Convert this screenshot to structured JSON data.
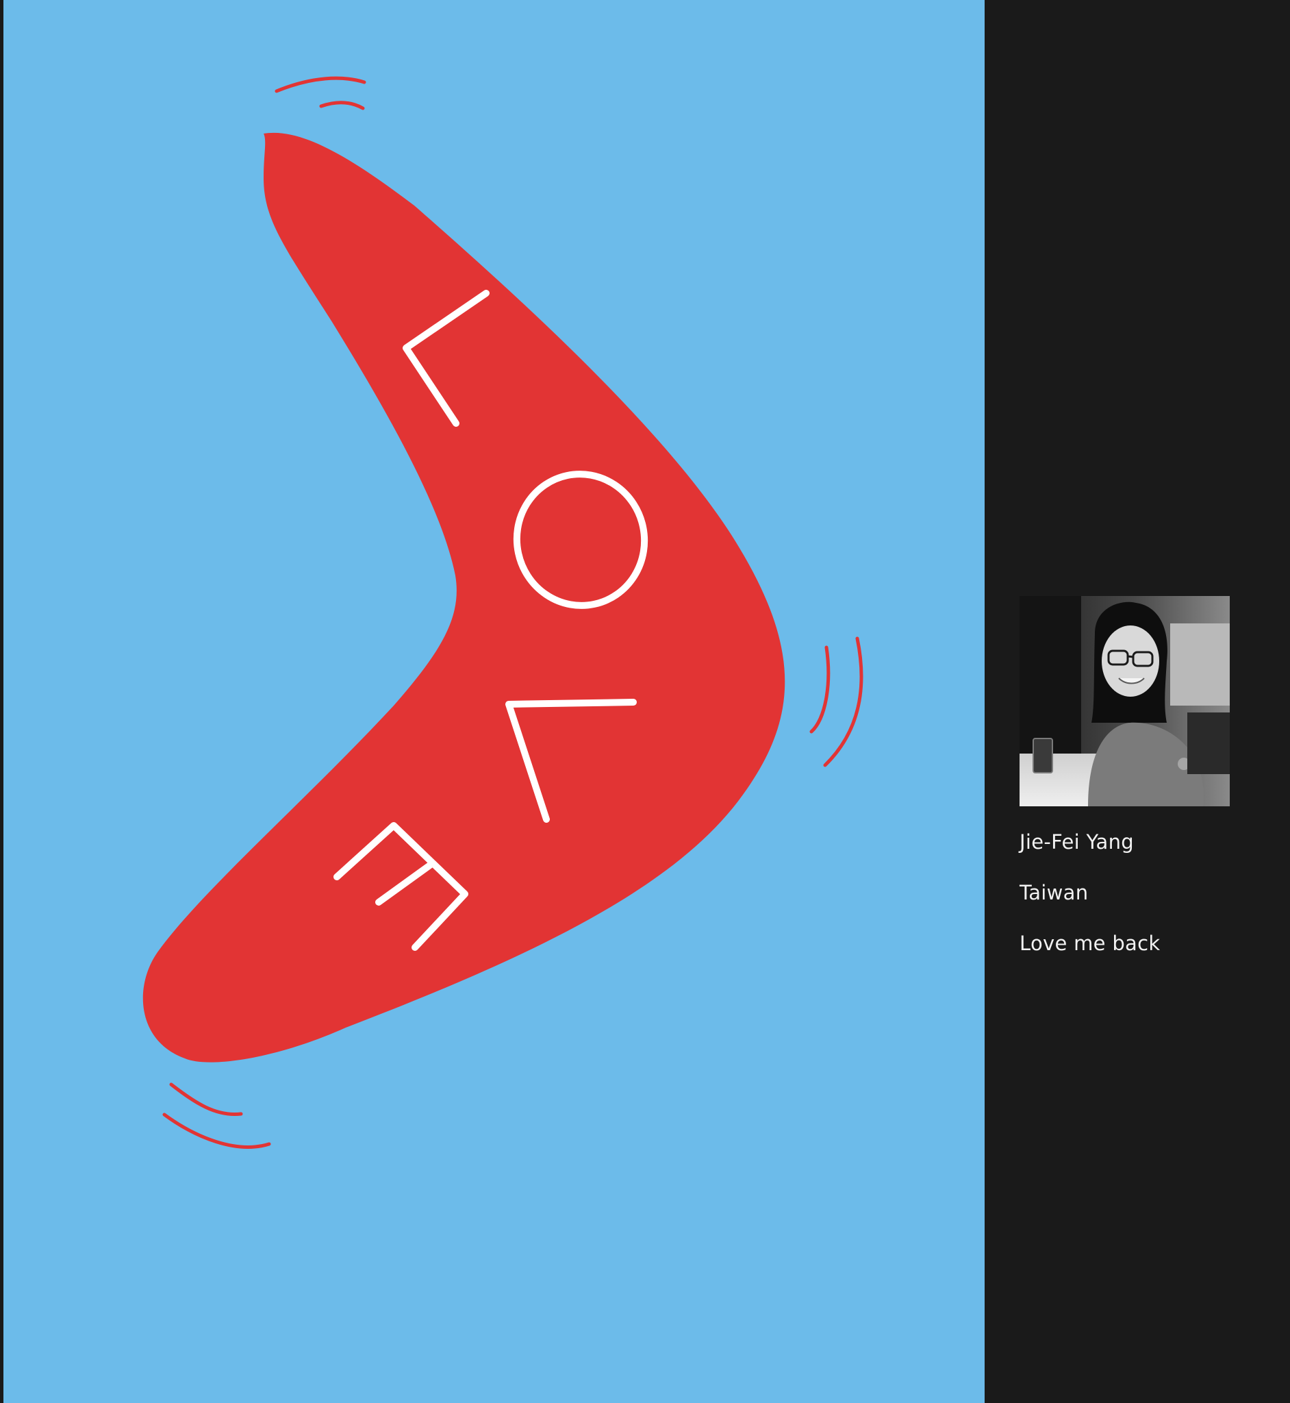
{
  "colors": {
    "artwork_background": "#6cbbea",
    "boomerang": "#e23434",
    "lettering": "#ffffff",
    "sidebar_background": "#1a1a1a",
    "sidebar_text": "#f2f2f2"
  },
  "artwork": {
    "lettering": "LOVE",
    "icons": [
      "boomerang-icon",
      "motion-line-icon"
    ]
  },
  "entry": {
    "photo_icon": "portrait-photo",
    "artist_name": "Jie-Fei Yang",
    "country": "Taiwan",
    "title": "Love me back"
  }
}
